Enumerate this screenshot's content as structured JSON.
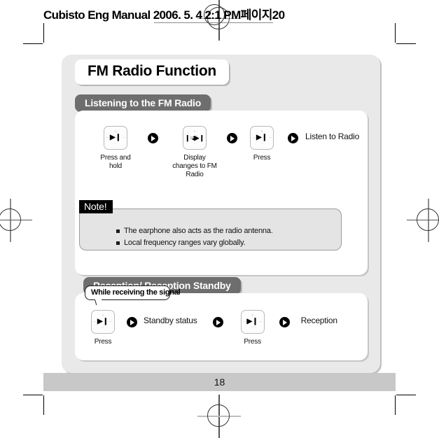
{
  "document": {
    "header_text": "Cubisto Eng Manual  2006. 5. 4 2:1 PM페이지20",
    "page_number": "18"
  },
  "title": {
    "text": "FM Radio Function"
  },
  "sections": [
    {
      "id": "listening",
      "heading": "Listening to the FM Radio",
      "steps": [
        {
          "icon": "device-play-pause-icon",
          "caption": "Press and\nhold"
        },
        {
          "icon": "device-skip-icon",
          "caption": "Display\nchanges to FM\nRadio"
        },
        {
          "icon": "device-play-pause-icon",
          "caption": "Press"
        }
      ],
      "result": "Listen to Radio"
    },
    {
      "id": "reception",
      "heading": "Reception/ Reception Standby",
      "bubble": "While receiving the signal",
      "steps": [
        {
          "icon": "device-play-pause-icon",
          "caption": "Press",
          "result": "Standby status"
        },
        {
          "icon": "device-play-pause-icon",
          "caption": "Press",
          "result": "Reception"
        }
      ]
    }
  ],
  "note": {
    "tag": "Note!",
    "items": [
      "The earphone also acts as the radio antenna.",
      "Local frequency ranges vary globally."
    ]
  },
  "glyphs": {
    "plus": "+",
    "minus": "-",
    "play_pause": "▶❙",
    "skip_back": "❙◀",
    "skip_fwd": "▶❙",
    "side_dash": "–"
  },
  "colors": {
    "panel_gray": "#e9e9e9",
    "tab_gray": "#6e6e6e",
    "note_gray": "#e4e4e4",
    "footer_gray": "#c8c8c8",
    "accent_black": "#000000"
  }
}
